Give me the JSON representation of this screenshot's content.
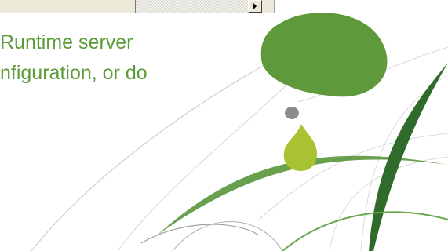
{
  "slide": {
    "text_line_1": "Runtime server",
    "text_line_2": "nfiguration, or do"
  },
  "colors": {
    "text": "#5c9a3a",
    "blob_green": "#5e9a3c",
    "drop_lime": "#a9c232",
    "dot_gray": "#8c8c8c",
    "swoosh_dark": "#2f6b2a"
  },
  "icons": {
    "scroll_right": "triangle-right"
  }
}
